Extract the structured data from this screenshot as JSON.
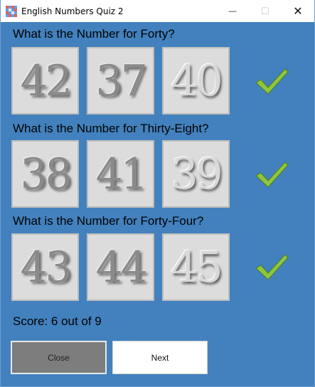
{
  "window": {
    "title": "English Numbers Quiz 2",
    "minimize_symbol": "—",
    "maximize_symbol": "☐",
    "close_symbol": "✕"
  },
  "questions": [
    {
      "text": "What is the Number for Forty?",
      "options": [
        "42",
        "37",
        "40"
      ],
      "result_icon": "check-icon"
    },
    {
      "text": "What is the Number for Thirty-Eight?",
      "options": [
        "38",
        "41",
        "39"
      ],
      "result_icon": "check-icon"
    },
    {
      "text": "What is the Number for Forty-Four?",
      "options": [
        "43",
        "44",
        "45"
      ],
      "result_icon": "check-icon"
    }
  ],
  "score": "Score: 6 out of 9",
  "buttons": {
    "close": "Close",
    "next": "Next"
  },
  "colors": {
    "background": "#4281bd",
    "tile": "#dcdcdc",
    "check": "#8dc63f"
  }
}
